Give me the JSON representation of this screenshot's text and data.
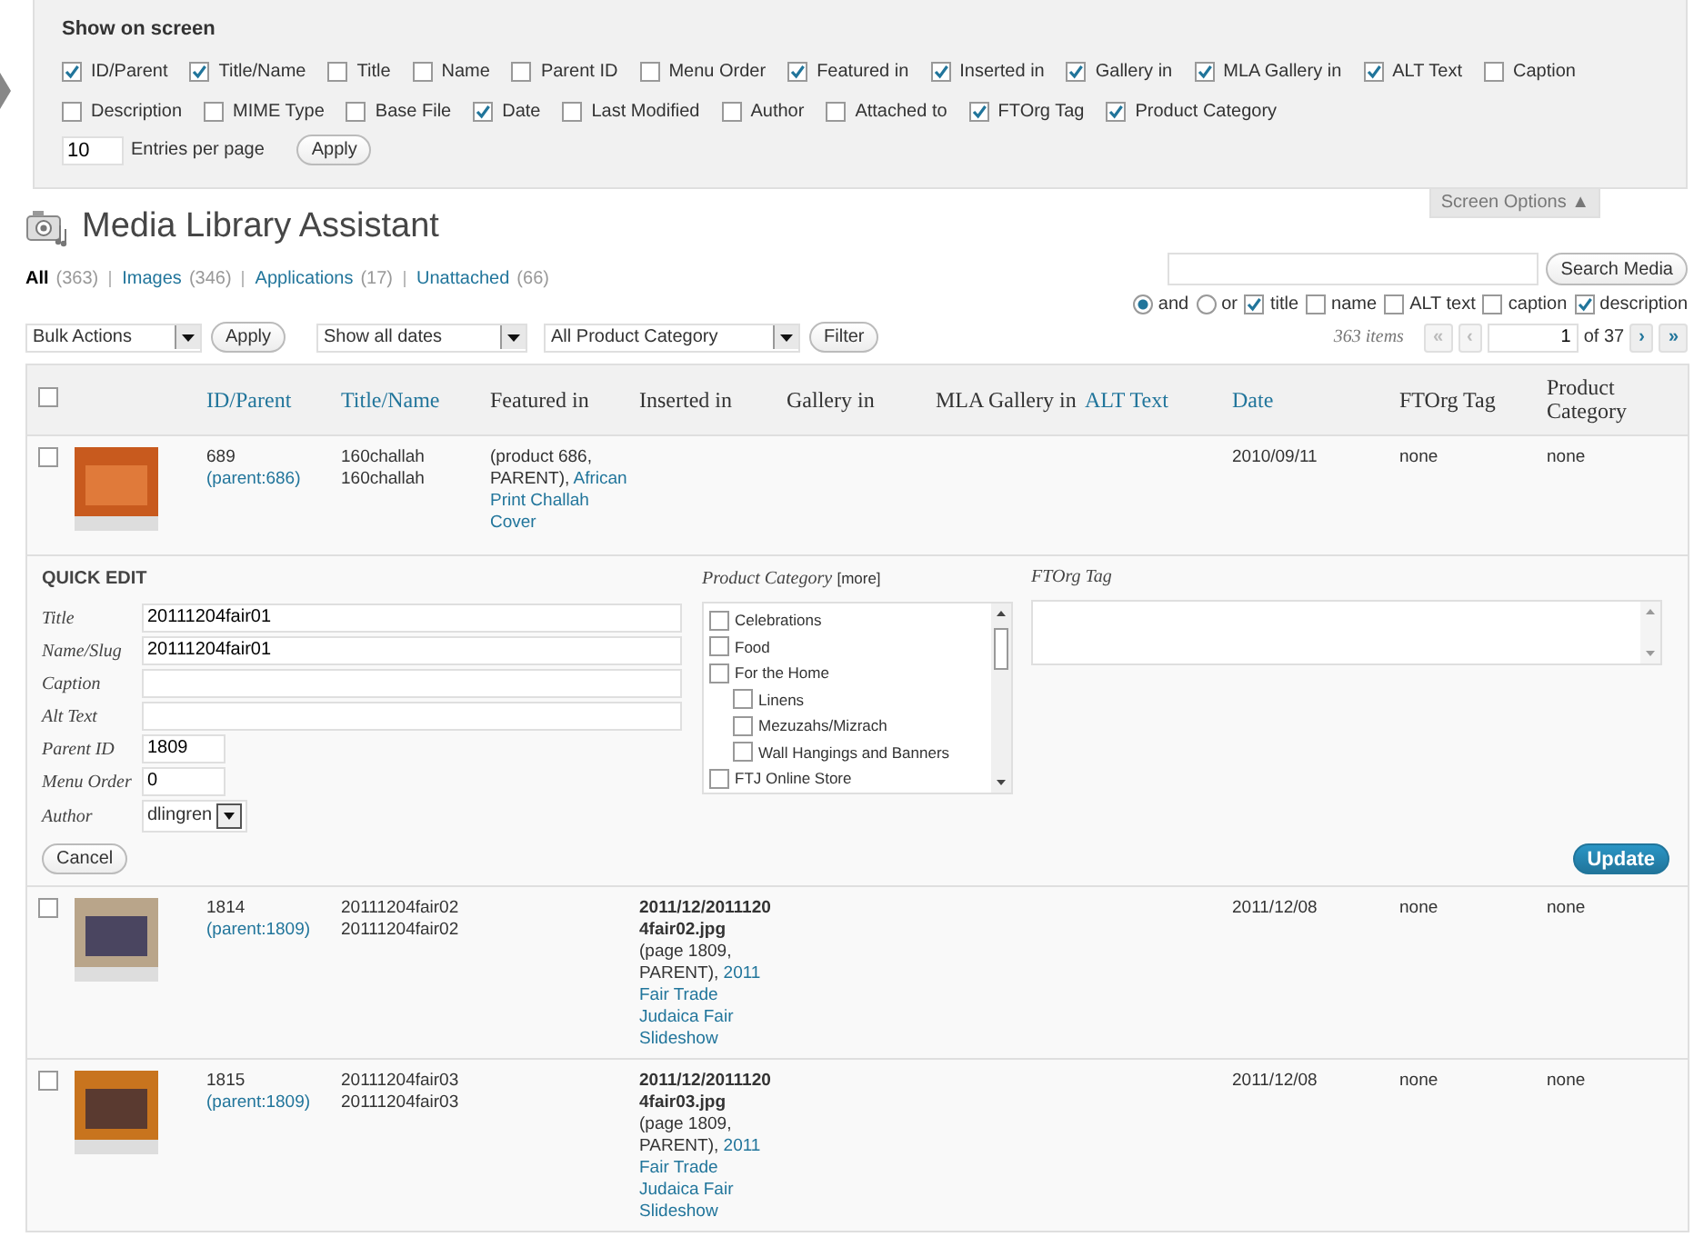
{
  "screen_options": {
    "title": "Show on screen",
    "columns": [
      {
        "label": "ID/Parent",
        "checked": true
      },
      {
        "label": "Title/Name",
        "checked": true
      },
      {
        "label": "Title",
        "checked": false
      },
      {
        "label": "Name",
        "checked": false
      },
      {
        "label": "Parent ID",
        "checked": false
      },
      {
        "label": "Menu Order",
        "checked": false
      },
      {
        "label": "Featured in",
        "checked": true
      },
      {
        "label": "Inserted in",
        "checked": true
      },
      {
        "label": "Gallery in",
        "checked": true
      },
      {
        "label": "MLA Gallery in",
        "checked": true
      },
      {
        "label": "ALT Text",
        "checked": true
      },
      {
        "label": "Caption",
        "checked": false
      },
      {
        "label": "Description",
        "checked": false
      },
      {
        "label": "MIME Type",
        "checked": false
      },
      {
        "label": "Base File",
        "checked": false
      },
      {
        "label": "Date",
        "checked": true
      },
      {
        "label": "Last Modified",
        "checked": false
      },
      {
        "label": "Author",
        "checked": false
      },
      {
        "label": "Attached to",
        "checked": false
      },
      {
        "label": "FTOrg Tag",
        "checked": true
      },
      {
        "label": "Product Category",
        "checked": true
      }
    ],
    "entries_value": "10",
    "entries_label": "Entries per page",
    "apply": "Apply",
    "tab": "Screen Options ▲"
  },
  "page_title": "Media Library Assistant",
  "filters": [
    {
      "label": "All",
      "count": "(363)",
      "selected": true
    },
    {
      "label": "Images",
      "count": "(346)",
      "selected": false
    },
    {
      "label": "Applications",
      "count": "(17)",
      "selected": false
    },
    {
      "label": "Unattached",
      "count": "(66)",
      "selected": false
    }
  ],
  "search": {
    "button": "Search Media",
    "options": [
      {
        "kind": "radio",
        "label": "and",
        "checked": true
      },
      {
        "kind": "radio",
        "label": "or",
        "checked": false
      },
      {
        "kind": "checkbox",
        "label": "title",
        "checked": true
      },
      {
        "kind": "checkbox",
        "label": "name",
        "checked": false
      },
      {
        "kind": "checkbox",
        "label": "ALT text",
        "checked": false
      },
      {
        "kind": "checkbox",
        "label": "caption",
        "checked": false
      },
      {
        "kind": "checkbox",
        "label": "description",
        "checked": true
      }
    ]
  },
  "toolbar": {
    "bulk_actions": "Bulk Actions",
    "apply": "Apply",
    "dates": "Show all dates",
    "category": "All Product Category",
    "filter": "Filter"
  },
  "pagination": {
    "items": "363 items",
    "buttons": [
      {
        "label": "«",
        "disabled": true
      },
      {
        "label": "‹",
        "disabled": true
      }
    ],
    "page": "1",
    "of": "of 37",
    "next_buttons": [
      {
        "label": "›",
        "disabled": false
      },
      {
        "label": "»",
        "disabled": false
      }
    ]
  },
  "table": {
    "select_all": false,
    "columns": [
      {
        "label": "ID/Parent",
        "sortable": true
      },
      {
        "label": "Title/Name",
        "sortable": true
      },
      {
        "label": "Featured in",
        "sortable": false
      },
      {
        "label": "Inserted in",
        "sortable": false
      },
      {
        "label": "Gallery in",
        "sortable": false
      },
      {
        "label": "MLA Gallery in",
        "sortable": false
      },
      {
        "label": "ALT Text",
        "sortable": true
      },
      {
        "label": "Date",
        "sortable": true
      },
      {
        "label": "FTOrg Tag",
        "sortable": false
      },
      {
        "label": "Product Category",
        "sortable": false
      }
    ],
    "rows": [
      {
        "checked": false,
        "id": "689",
        "parent": "(parent:686)",
        "title": "160challah",
        "name": "160challah",
        "featured_in": [
          {
            "kind": "plain",
            "text": "(product 686, PARENT),"
          },
          {
            "kind": "link",
            "text": "African Print Challah Cover"
          }
        ],
        "inserted_in": [],
        "date": "2010/09/11",
        "ftorg_tag": "none",
        "product_category": "none",
        "quick_edit": {
          "heading": "QUICK EDIT",
          "fields": [
            {
              "kind": "text",
              "label": "Title",
              "value": "20111204fair01"
            },
            {
              "kind": "text",
              "label": "Name/Slug",
              "value": "20111204fair01"
            },
            {
              "kind": "text",
              "label": "Caption"
            },
            {
              "kind": "text",
              "label": "Alt Text"
            },
            {
              "kind": "short",
              "label": "Parent ID",
              "value": "1809"
            },
            {
              "kind": "short",
              "label": "Menu Order",
              "value": "0"
            },
            {
              "kind": "select",
              "label": "Author",
              "value": "dlingren"
            }
          ],
          "category_label": "Product Category",
          "category_more": "[more]",
          "categories": [
            {
              "label": "Celebrations",
              "checked": false
            },
            {
              "label": "Food",
              "checked": false
            },
            {
              "label": "For the Home",
              "checked": false,
              "children": [
                {
                  "label": "Linens",
                  "checked": false
                },
                {
                  "label": "Mezuzahs/Mizrach",
                  "checked": false
                },
                {
                  "label": "Wall Hangings and Banners",
                  "checked": false
                }
              ]
            },
            {
              "label": "FTJ Online Store",
              "checked": false
            }
          ],
          "tag_label": "FTOrg Tag",
          "cancel": "Cancel",
          "update": "Update"
        }
      },
      {
        "checked": false,
        "id": "1814",
        "parent": "(parent:1809)",
        "title": "20111204fair02",
        "name": "20111204fair02",
        "featured_in": [],
        "inserted_in": [
          {
            "kind": "bold",
            "text": "2011/12/20111204fair02.jpg"
          },
          {
            "kind": "plain",
            "text": "(page 1809, PARENT),"
          },
          {
            "kind": "link",
            "text": "2011 Fair Trade Judaica Fair Slideshow"
          }
        ],
        "date": "2011/12/08",
        "ftorg_tag": "none",
        "product_category": "none"
      },
      {
        "checked": false,
        "id": "1815",
        "parent": "(parent:1809)",
        "title": "20111204fair03",
        "name": "20111204fair03",
        "featured_in": [],
        "inserted_in": [
          {
            "kind": "bold",
            "text": "2011/12/20111204fair03.jpg"
          },
          {
            "kind": "plain",
            "text": "(page 1809, PARENT),"
          },
          {
            "kind": "link",
            "text": "2011 Fair Trade Judaica Fair Slideshow"
          }
        ],
        "date": "2011/12/08",
        "ftorg_tag": "none",
        "product_category": "none"
      }
    ]
  }
}
